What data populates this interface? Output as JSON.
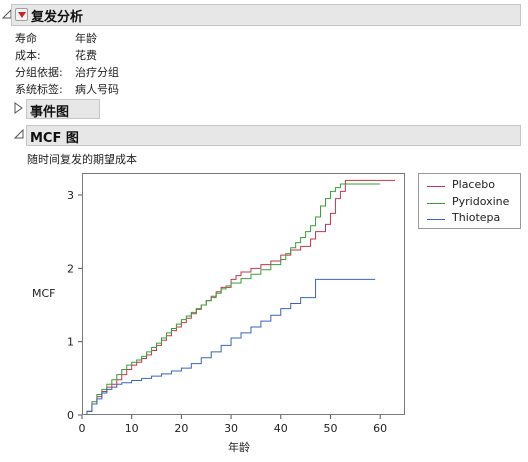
{
  "report": {
    "title": "复发分析",
    "info": [
      {
        "label": "寿命",
        "value": "年龄"
      },
      {
        "label": "成本:",
        "value": "花费"
      },
      {
        "label": "分组依据:",
        "value": "治疗分组"
      },
      {
        "label": "系统标签:",
        "value": "病人号码"
      }
    ]
  },
  "events_section": {
    "title": "事件图"
  },
  "mcf_section": {
    "title": "MCF 图",
    "subtitle": "随时间复发的期望成本"
  },
  "colors": {
    "Placebo": "#c8344b",
    "Pyridoxine": "#3a9d3a",
    "Thiotepa": "#3a64bc"
  },
  "chart_data": {
    "type": "line",
    "xlabel": "年龄",
    "ylabel": "MCF",
    "xlim": [
      0,
      65
    ],
    "ylim": [
      0,
      3.3
    ],
    "xticks": [
      0,
      10,
      20,
      30,
      40,
      50,
      60
    ],
    "yticks": [
      0,
      1,
      2,
      3
    ],
    "legend_position": "right",
    "series": [
      {
        "name": "Placebo",
        "color": "#c8344b",
        "x": [
          1,
          2,
          3,
          4,
          5,
          6,
          7,
          8,
          9,
          10,
          11,
          12,
          13,
          14,
          15,
          16,
          17,
          18,
          19,
          20,
          21,
          22,
          23,
          24,
          25,
          26,
          27,
          28,
          30,
          31,
          32,
          34,
          36,
          38,
          40,
          42,
          44,
          46,
          47,
          49,
          50,
          51,
          52,
          53,
          63
        ],
        "y": [
          0.05,
          0.15,
          0.25,
          0.32,
          0.38,
          0.42,
          0.48,
          0.55,
          0.62,
          0.68,
          0.72,
          0.77,
          0.82,
          0.88,
          0.95,
          1.02,
          1.08,
          1.15,
          1.2,
          1.26,
          1.32,
          1.38,
          1.44,
          1.5,
          1.56,
          1.62,
          1.68,
          1.74,
          1.85,
          1.9,
          1.95,
          2.0,
          2.05,
          2.1,
          2.18,
          2.25,
          2.3,
          2.4,
          2.5,
          2.6,
          2.75,
          2.95,
          3.05,
          3.2,
          3.2
        ]
      },
      {
        "name": "Pyridoxine",
        "color": "#3a9d3a",
        "x": [
          1,
          2,
          3,
          4,
          5,
          6,
          7,
          8,
          9,
          10,
          11,
          12,
          13,
          14,
          15,
          16,
          17,
          18,
          19,
          20,
          21,
          22,
          23,
          24,
          25,
          26,
          27,
          28,
          29,
          30,
          32,
          34,
          36,
          38,
          40,
          41,
          42,
          43,
          44,
          45,
          46,
          47,
          48,
          49,
          50,
          51,
          52,
          60
        ],
        "y": [
          0.05,
          0.18,
          0.28,
          0.35,
          0.42,
          0.48,
          0.55,
          0.62,
          0.68,
          0.72,
          0.75,
          0.8,
          0.86,
          0.92,
          0.98,
          1.05,
          1.12,
          1.18,
          1.24,
          1.3,
          1.35,
          1.4,
          1.45,
          1.5,
          1.56,
          1.6,
          1.66,
          1.72,
          1.76,
          1.8,
          1.86,
          1.92,
          1.98,
          2.05,
          2.12,
          2.2,
          2.28,
          2.35,
          2.42,
          2.5,
          2.58,
          2.7,
          2.85,
          2.95,
          3.05,
          3.1,
          3.15,
          3.15
        ]
      },
      {
        "name": "Thiotepa",
        "color": "#3a64bc",
        "x": [
          1,
          2,
          3,
          4,
          5,
          6,
          7,
          8,
          10,
          12,
          14,
          16,
          18,
          20,
          22,
          24,
          26,
          28,
          30,
          32,
          34,
          36,
          38,
          40,
          42,
          44,
          47,
          52,
          59
        ],
        "y": [
          0.05,
          0.15,
          0.22,
          0.3,
          0.35,
          0.38,
          0.42,
          0.44,
          0.47,
          0.5,
          0.53,
          0.56,
          0.6,
          0.64,
          0.7,
          0.78,
          0.86,
          0.95,
          1.05,
          1.12,
          1.2,
          1.28,
          1.36,
          1.45,
          1.52,
          1.6,
          1.85,
          1.85,
          1.85
        ]
      }
    ]
  }
}
